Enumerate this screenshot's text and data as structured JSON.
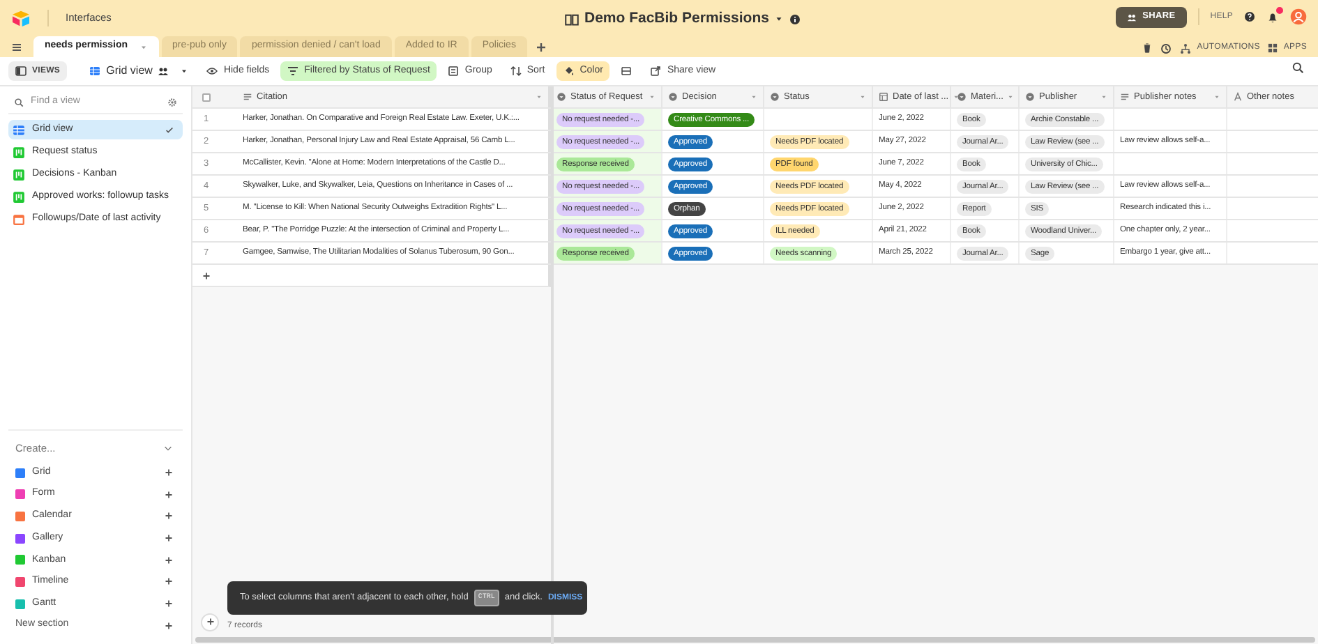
{
  "header": {
    "section": "Interfaces",
    "title": "Demo FacBib Permissions",
    "share": "SHARE",
    "help": "HELP",
    "automations": "AUTOMATIONS",
    "apps": "APPS"
  },
  "tabs": [
    {
      "label": "needs permission",
      "selected": true
    },
    {
      "label": "pre-pub only",
      "selected": false
    },
    {
      "label": "permission denied / can't load",
      "selected": false
    },
    {
      "label": "Added to IR",
      "selected": false
    },
    {
      "label": "Policies",
      "selected": false
    }
  ],
  "toolbar": {
    "views": "VIEWS",
    "view_name": "Grid view",
    "hide_fields": "Hide fields",
    "filter": "Filtered by Status of Request",
    "group": "Group",
    "sort": "Sort",
    "color_label": "Color",
    "share_view": "Share view"
  },
  "sidebar": {
    "search_placeholder": "Find a view",
    "views": [
      {
        "label": "Grid view",
        "kind": "grid",
        "selected": true
      },
      {
        "label": "Request status",
        "kind": "kanban",
        "selected": false
      },
      {
        "label": "Decisions - Kanban",
        "kind": "kanban",
        "selected": false
      },
      {
        "label": "Approved works: followup tasks",
        "kind": "kanban",
        "selected": false
      },
      {
        "label": "Followups/Date of last activity",
        "kind": "calendar",
        "selected": false
      }
    ],
    "create_label": "Create...",
    "create_items": [
      {
        "label": "Grid",
        "color": "#2d7ff9"
      },
      {
        "label": "Form",
        "color": "#ee3fb3"
      },
      {
        "label": "Calendar",
        "color": "#f87341"
      },
      {
        "label": "Gallery",
        "color": "#8b46ff"
      },
      {
        "label": "Kanban",
        "color": "#20c933"
      },
      {
        "label": "Timeline",
        "color": "#f0466e"
      },
      {
        "label": "Gantt",
        "color": "#18bfad"
      }
    ],
    "new_section": "New section"
  },
  "table": {
    "columns": [
      {
        "label": "Citation",
        "kind": "longtext"
      },
      {
        "label": "Status of Request",
        "kind": "select"
      },
      {
        "label": "Decision",
        "kind": "select"
      },
      {
        "label": "Status",
        "kind": "select"
      },
      {
        "label": "Date of last ...",
        "kind": "date"
      },
      {
        "label": "Materi...",
        "kind": "select"
      },
      {
        "label": "Publisher",
        "kind": "select"
      },
      {
        "label": "Publisher notes",
        "kind": "longtext"
      },
      {
        "label": "Other notes",
        "kind": "text"
      }
    ],
    "rows": [
      {
        "number": "1",
        "citation": "Harker, Jonathan. On Comparative and Foreign Real Estate Law. Exeter, U.K.:...",
        "request": {
          "label": "No request needed -...",
          "color": "#dccbfa"
        },
        "decision": {
          "label": "Creative Commons ...",
          "color": "#338a17"
        },
        "date": "June 2, 2022",
        "material": "Book",
        "publisher": "Archie Constable ..."
      },
      {
        "number": "2",
        "citation": "Harker, Jonathan, Personal Injury Law and Real Estate Appraisal, 56 Camb L...",
        "request": {
          "label": "No request needed -...",
          "color": "#dccbfa"
        },
        "decision": {
          "label": "Approved",
          "color": "#1a6fb8"
        },
        "status": {
          "label": "Needs PDF located",
          "color": "#ffeab6"
        },
        "date": "May 27, 2022",
        "material": "Journal Ar...",
        "publisher": "Law Review (see ...",
        "publisher_notes": "Law review allows self-a..."
      },
      {
        "number": "3",
        "citation": "McCallister, Kevin. \"Alone at Home: Modern Interpretations of the Castle D...",
        "request": {
          "label": "Response received",
          "color": "#aae898"
        },
        "decision": {
          "label": "Approved",
          "color": "#1a6fb8"
        },
        "status": {
          "label": "PDF found",
          "color": "#ffd66e"
        },
        "date": "June 7, 2022",
        "material": "Book",
        "publisher": "University of Chic..."
      },
      {
        "number": "4",
        "citation": "Skywalker, Luke, and Skywalker, Leia, Questions on Inheritance in Cases of ...",
        "request": {
          "label": "No request needed -...",
          "color": "#dccbfa"
        },
        "decision": {
          "label": "Approved",
          "color": "#1a6fb8"
        },
        "status": {
          "label": "Needs PDF located",
          "color": "#ffeab6"
        },
        "date": "May 4, 2022",
        "material": "Journal Ar...",
        "publisher": "Law Review (see ...",
        "publisher_notes": "Law review allows self-a..."
      },
      {
        "number": "5",
        "citation": "M. \"License to Kill: When National Security Outweighs Extradition Rights\" L...",
        "request": {
          "label": "No request needed -...",
          "color": "#dccbfa"
        },
        "decision": {
          "label": "Orphan",
          "color": "#444444"
        },
        "status": {
          "label": "Needs PDF located",
          "color": "#ffeab6"
        },
        "date": "June 2, 2022",
        "material": "Report",
        "publisher": "SIS",
        "publisher_notes": "Research indicated this i..."
      },
      {
        "number": "6",
        "citation": "Bear, P. \"The Porridge Puzzle: At the intersection of Criminal and Property L...",
        "request": {
          "label": "No request needed -...",
          "color": "#dccbfa"
        },
        "decision": {
          "label": "Approved",
          "color": "#1a6fb8"
        },
        "status": {
          "label": "ILL needed",
          "color": "#ffeab6"
        },
        "date": "April 21, 2022",
        "material": "Book",
        "publisher": "Woodland Univer...",
        "publisher_notes": "One chapter only, 2 year..."
      },
      {
        "number": "7",
        "citation": "Gamgee, Samwise, The Utilitarian Modalities of Solanus Tuberosum, 90 Gon...",
        "request": {
          "label": "Response received",
          "color": "#aae898"
        },
        "decision": {
          "label": "Approved",
          "color": "#1a6fb8"
        },
        "status": {
          "label": "Needs scanning",
          "color": "#d1f7c4"
        },
        "date": "March 25, 2022",
        "material": "Journal Ar...",
        "publisher": "Sage",
        "publisher_notes": "Embargo 1 year, give att..."
      }
    ],
    "record_count": "7 records",
    "select_all_checked": false
  },
  "toast": {
    "text_before": "To select columns that aren't adjacent to each other, hold",
    "key": "CTRL",
    "text_after": "and click.",
    "action": "DISMISS"
  }
}
